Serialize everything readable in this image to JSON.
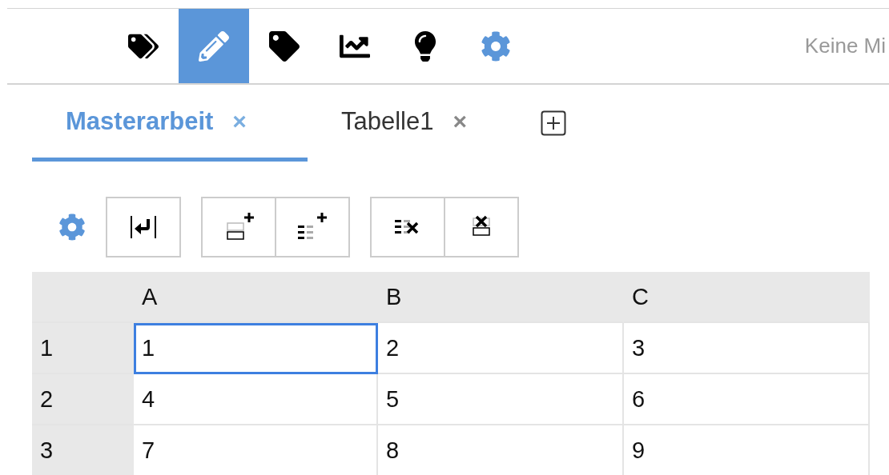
{
  "nav": {
    "items": [
      {
        "kind": "tags",
        "selected": false
      },
      {
        "kind": "pencil",
        "selected": true
      },
      {
        "kind": "tag",
        "selected": false
      },
      {
        "kind": "chart",
        "selected": false
      },
      {
        "kind": "bulb",
        "selected": false
      },
      {
        "kind": "gear",
        "selected": false
      }
    ],
    "status": "Keine Mi"
  },
  "tabs": [
    {
      "label": "Masterarbeit",
      "close": "×",
      "selected": true
    },
    {
      "label": "Tabelle1",
      "close": "×",
      "selected": false
    }
  ],
  "toolbar": {
    "groups": [
      {
        "buttons": [
          {
            "kind": "wrap"
          }
        ]
      },
      {
        "buttons": [
          {
            "kind": "add-row"
          },
          {
            "kind": "add-column"
          }
        ]
      },
      {
        "buttons": [
          {
            "kind": "delete-column"
          },
          {
            "kind": "delete-row"
          }
        ]
      }
    ]
  },
  "grid": {
    "columns": [
      "A",
      "B",
      "C"
    ],
    "rows": [
      {
        "header": "1",
        "cells": [
          {
            "text": "1",
            "selected": true
          },
          {
            "text": "2",
            "selected": false
          },
          {
            "text": "3",
            "selected": false
          }
        ]
      },
      {
        "header": "2",
        "cells": [
          {
            "text": "4",
            "selected": false
          },
          {
            "text": "5",
            "selected": false
          },
          {
            "text": "6",
            "selected": false
          }
        ]
      },
      {
        "header": "3",
        "cells": [
          {
            "text": "7",
            "selected": false
          },
          {
            "text": "8",
            "selected": false
          },
          {
            "text": "9",
            "selected": false
          }
        ]
      }
    ]
  }
}
